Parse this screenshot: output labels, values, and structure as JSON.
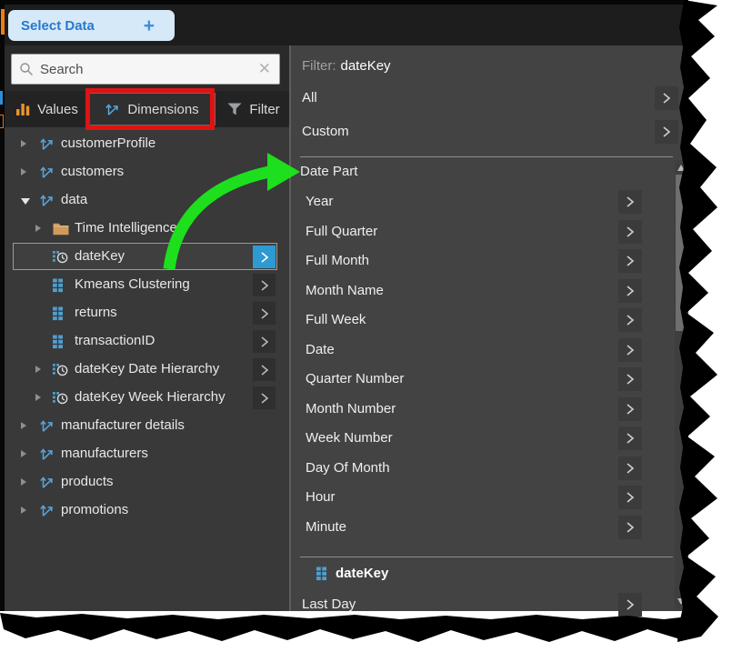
{
  "header": {
    "select_data_label": "Select Data",
    "plus_glyph": "+"
  },
  "search": {
    "placeholder": "Search",
    "clear_glyph": "✕"
  },
  "tabs": [
    {
      "label": "Values",
      "icon": "bars"
    },
    {
      "label": "Dimensions",
      "icon": "axes",
      "selected": true,
      "annotated": "red box"
    },
    {
      "label": "Filter",
      "icon": "funnel"
    }
  ],
  "tree": {
    "items": [
      {
        "label": "customerProfile",
        "icon": "axes",
        "caret": "collapsed",
        "level": 0
      },
      {
        "label": "customers",
        "icon": "axes",
        "caret": "collapsed",
        "level": 0
      },
      {
        "label": "data",
        "icon": "axes",
        "caret": "expanded",
        "level": 0
      },
      {
        "label": "Time Intelligence",
        "icon": "folder",
        "caret": "collapsed",
        "level": 1
      },
      {
        "label": "dateKey",
        "icon": "datetime",
        "caret": "none",
        "level": 1,
        "selected": true,
        "chevron": "blue"
      },
      {
        "label": "Kmeans Clustering",
        "icon": "grid",
        "caret": "none",
        "level": 1,
        "chevron": "dark"
      },
      {
        "label": "returns",
        "icon": "grid",
        "caret": "none",
        "level": 1,
        "chevron": "dark"
      },
      {
        "label": "transactionID",
        "icon": "grid",
        "caret": "none",
        "level": 1,
        "chevron": "dark"
      },
      {
        "label": "dateKey Date Hierarchy",
        "icon": "datetime",
        "caret": "collapsed",
        "level": 1,
        "chevron": "dark"
      },
      {
        "label": "dateKey Week Hierarchy",
        "icon": "datetime",
        "caret": "collapsed",
        "level": 1,
        "chevron": "dark"
      },
      {
        "label": "manufacturer details",
        "icon": "axes",
        "caret": "collapsed",
        "level": 0
      },
      {
        "label": "manufacturers",
        "icon": "axes",
        "caret": "collapsed",
        "level": 0
      },
      {
        "label": "products",
        "icon": "axes",
        "caret": "collapsed",
        "level": 0
      },
      {
        "label": "promotions",
        "icon": "axes",
        "caret": "collapsed",
        "level": 0
      }
    ]
  },
  "filter_panel": {
    "title_prefix": "Filter:",
    "title_field": "dateKey",
    "top_items": [
      {
        "label": "All"
      },
      {
        "label": "Custom"
      }
    ],
    "section_heading": "Date Part",
    "date_parts": [
      "Year",
      "Full Quarter",
      "Full Month",
      "Month Name",
      "Full Week",
      "Date",
      "Quarter Number",
      "Month Number",
      "Week Number",
      "Day Of Month",
      "Hour",
      "Minute"
    ],
    "footer": {
      "field_name": "dateKey",
      "items": [
        "Last Day"
      ]
    }
  },
  "colors": {
    "accent_blue_button": "#2e9ad2",
    "icon_blue": "#4f9fd0",
    "values_orange": "#e8962e",
    "folder_orange": "#cf9a5e",
    "annotation_red": "#e01212",
    "annotation_green": "#1ddf1d",
    "select_button_bg": "#d6e9f8",
    "select_button_text": "#2879cc"
  }
}
